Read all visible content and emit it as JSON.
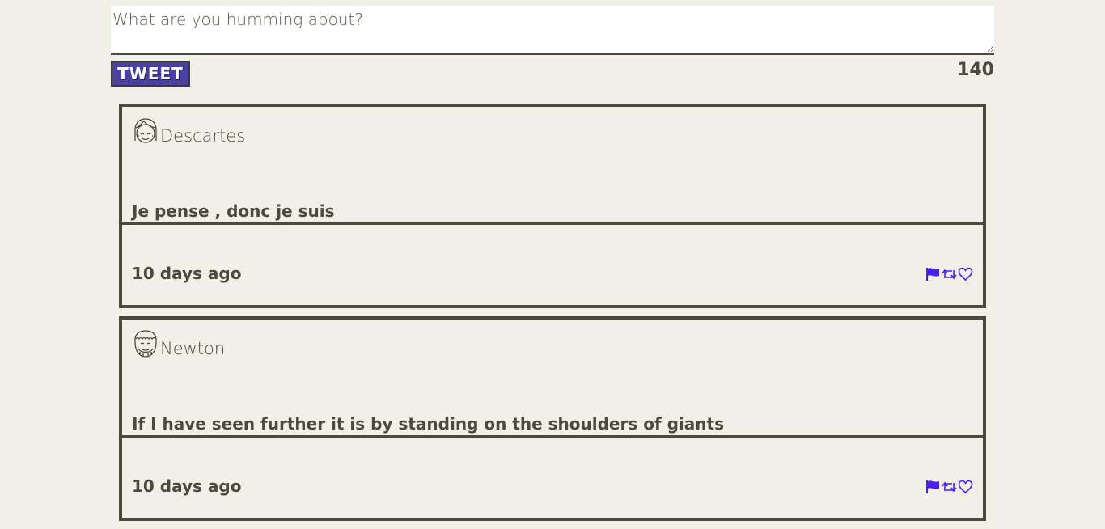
{
  "composer": {
    "placeholder": "What are you humming about?",
    "tweet_label": "TWEET",
    "char_count": "140"
  },
  "tweets": [
    {
      "author": "Descartes",
      "avatar_icon": "girl-face-icon",
      "text": "Je pense , donc je suis",
      "timestamp": "10 days ago",
      "actions": [
        "flag-icon",
        "retweet-icon",
        "heart-icon"
      ]
    },
    {
      "author": "Newton",
      "avatar_icon": "bearded-face-icon",
      "text": "If I have seen further it is by standing on the shoulders of giants",
      "timestamp": "10 days ago",
      "actions": [
        "flag-icon",
        "retweet-icon",
        "heart-icon"
      ]
    }
  ],
  "colors": {
    "background": "#f0efe8",
    "text": "#4a4a40",
    "button": "#4b3fa0",
    "action_icons": "#4a1ff0"
  }
}
